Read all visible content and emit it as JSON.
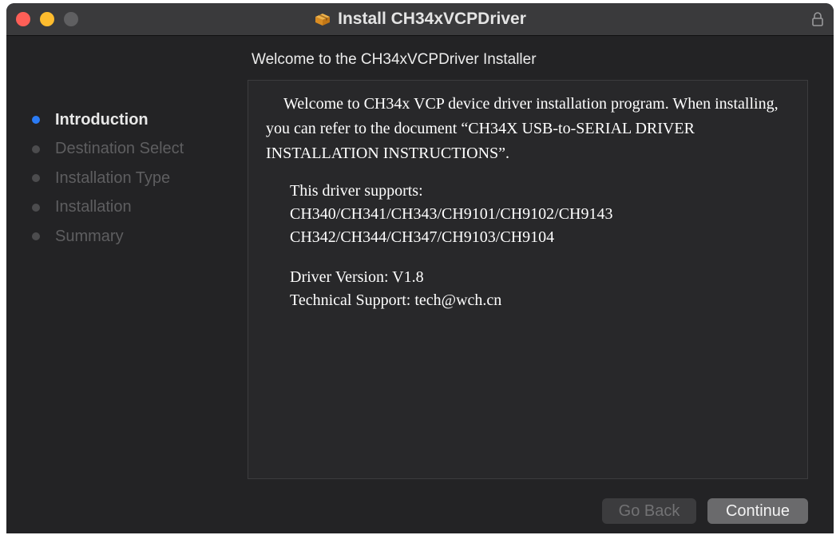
{
  "window": {
    "title": "Install CH34xVCPDriver"
  },
  "heading": "Welcome to the CH34xVCPDriver Installer",
  "steps": [
    {
      "label": "Introduction",
      "active": true
    },
    {
      "label": "Destination Select",
      "active": false
    },
    {
      "label": "Installation Type",
      "active": false
    },
    {
      "label": "Installation",
      "active": false
    },
    {
      "label": "Summary",
      "active": false
    }
  ],
  "content": {
    "intro": "Welcome to CH34x VCP device driver installation program. When installing, you can refer to the document “CH34X USB-to-SERIAL DRIVER INSTALLATION INSTRUCTIONS”.",
    "supports_title": "This driver supports:",
    "supports_line1": "CH340/CH341/CH343/CH9101/CH9102/CH9143",
    "supports_line2": "CH342/CH344/CH347/CH9103/CH9104",
    "driver_version": "Driver Version: V1.8",
    "support": "Technical Support: tech@wch.cn"
  },
  "buttons": {
    "back": "Go Back",
    "continue": "Continue"
  },
  "colors": {
    "accent": "#2b7bf5",
    "close": "#fe5f57",
    "minimize": "#febc2e"
  },
  "icons": {
    "title": "package-icon",
    "lock": "lock-icon"
  }
}
